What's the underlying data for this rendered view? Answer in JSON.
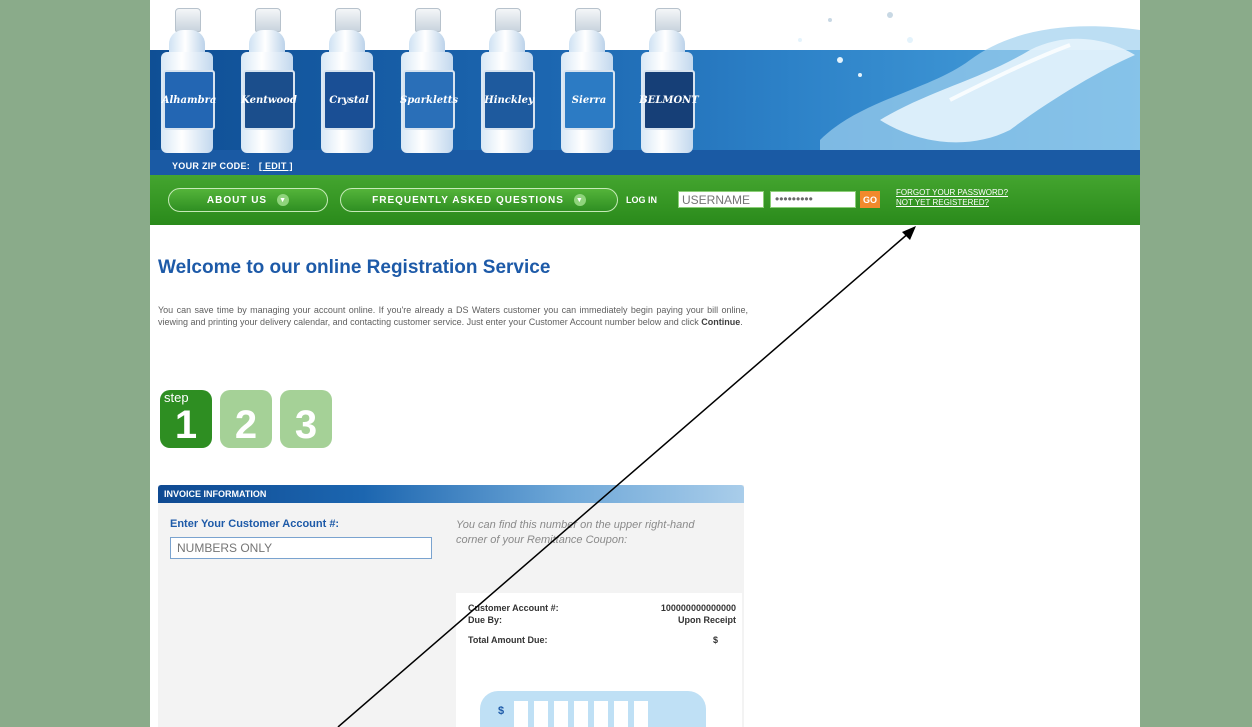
{
  "header": {
    "brands": [
      "Alhambra",
      "Kentwood",
      "Crystal",
      "Sparkletts",
      "Hinckley",
      "Sierra",
      "BELMONT"
    ],
    "zip_label": "YOUR ZIP CODE:",
    "zip_edit": "[ EDIT ]"
  },
  "nav": {
    "about": "ABOUT US",
    "faq": "FREQUENTLY ASKED QUESTIONS",
    "login_label": "LOG IN",
    "username_placeholder": "USERNAME",
    "password_value": "•••••••••",
    "go": "GO",
    "forgot": "FORGOT YOUR PASSWORD?",
    "register": "NOT YET REGISTERED?"
  },
  "main": {
    "title": "Welcome to our online Registration Service",
    "intro": "You can save time by managing your account online. If you're already a DS Waters customer you can immediately begin paying your bill online, viewing and printing your delivery calendar, and contacting customer service. Just enter your Customer Account number below and click",
    "intro_bold": "Continue",
    "step_label": "step",
    "steps": [
      "1",
      "2",
      "3"
    ]
  },
  "invoice": {
    "heading": "INVOICE INFORMATION",
    "account_label": "Enter Your Customer Account #:",
    "account_placeholder": "NUMBERS ONLY",
    "hint": "You can find this number on the upper right-hand corner of your Remittance Coupon:",
    "coupon": {
      "account_label": "Customer Account #:",
      "account_value": "100000000000000",
      "due_label": "Due By:",
      "due_value": "Upon Receipt",
      "total_label": "Total Amount Due:",
      "total_value": "$",
      "dollar_sign": "$"
    }
  },
  "colors": {
    "background": "#8aab8a",
    "nav_green": "#3a9a28",
    "brand_blue": "#1d5aa8",
    "go_orange": "#f2892c"
  }
}
